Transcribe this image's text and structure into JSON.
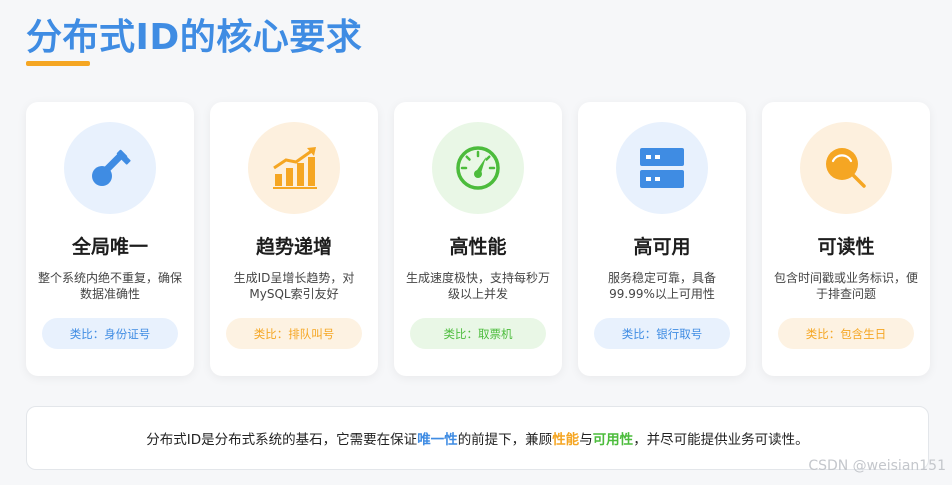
{
  "page": {
    "title": "分布式ID的核心要求"
  },
  "colors": {
    "title_blue": "#3f8ce3",
    "accent_orange": "#f5a623",
    "accent_green": "#4cbc3c"
  },
  "cards": [
    {
      "icon": "key-icon",
      "title": "全局唯一",
      "desc": "整个系统内绝不重复，确保数据准确性",
      "analogy": "类比：身份证号",
      "circle_bg": "#e8f1fd",
      "pill_bg": "#e8f1fd",
      "pill_color": "#3f8ce3"
    },
    {
      "icon": "trend-chart-icon",
      "title": "趋势递增",
      "desc": "生成ID呈增长趋势，对MySQL索引友好",
      "analogy": "类比：排队叫号",
      "circle_bg": "#fdf0de",
      "pill_bg": "#fdf2e2",
      "pill_color": "#f5a623"
    },
    {
      "icon": "speedometer-icon",
      "title": "高性能",
      "desc": "生成速度极快，支持每秒万级以上并发",
      "analogy": "类比：取票机",
      "circle_bg": "#e9f7e6",
      "pill_bg": "#e9f7e6",
      "pill_color": "#4cbc3c"
    },
    {
      "icon": "server-icon",
      "title": "高可用",
      "desc": "服务稳定可靠，具备99.99%以上可用性",
      "analogy": "类比：银行取号",
      "circle_bg": "#e8f1fd",
      "pill_bg": "#e8f1fd",
      "pill_color": "#3f8ce3"
    },
    {
      "icon": "search-icon",
      "title": "可读性",
      "desc": "包含时间戳或业务标识，便于排查问题",
      "analogy": "类比：包含生日",
      "circle_bg": "#fdf0de",
      "pill_bg": "#fdf2e2",
      "pill_color": "#f5a623"
    }
  ],
  "footer": {
    "text_1": "分布式ID是分布式系统的基石，它需要在保证",
    "highlight_1": "唯一性",
    "text_2": "的前提下，兼顾",
    "highlight_2": "性能",
    "text_3": "与",
    "highlight_3": "可用性",
    "text_4": "，并尽可能提供业务可读性。"
  },
  "watermark": "CSDN @weisian151"
}
